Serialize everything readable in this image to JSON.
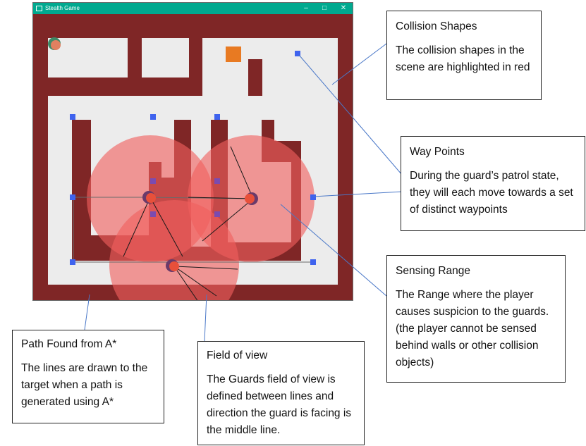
{
  "window": {
    "title": "Stealth Game",
    "min_glyph": "–",
    "max_glyph": "□",
    "close_glyph": "✕"
  },
  "colors": {
    "titlebar": "#00a98f",
    "wall": "#7f2626",
    "floor": "#ececec",
    "waypoint": "#3f63ee",
    "waypoint_inner": "#7b4bb0",
    "sensing_range": "#f0605d",
    "guard": "#e8503a",
    "player": "#e08060",
    "target": "#e87a22"
  },
  "callouts": {
    "collision": {
      "title": "Collision Shapes",
      "body": "The collision shapes in the scene are highlighted in red"
    },
    "waypoints": {
      "title": "Way Points",
      "body": "During the guard’s patrol state, they will each move towards a set of distinct waypoints"
    },
    "sensing": {
      "title": "Sensing Range",
      "body": "The Range where the player causes suspicion to the guards. (the player cannot be sensed behind walls or other collision objects)"
    },
    "path": {
      "title": "Path Found from A*",
      "body": "The lines are drawn to the target when a path is generated using A*"
    },
    "fov": {
      "title": "Field of view",
      "body": "The Guards field of view is defined between lines and direction the guard is facing is the middle line."
    }
  }
}
